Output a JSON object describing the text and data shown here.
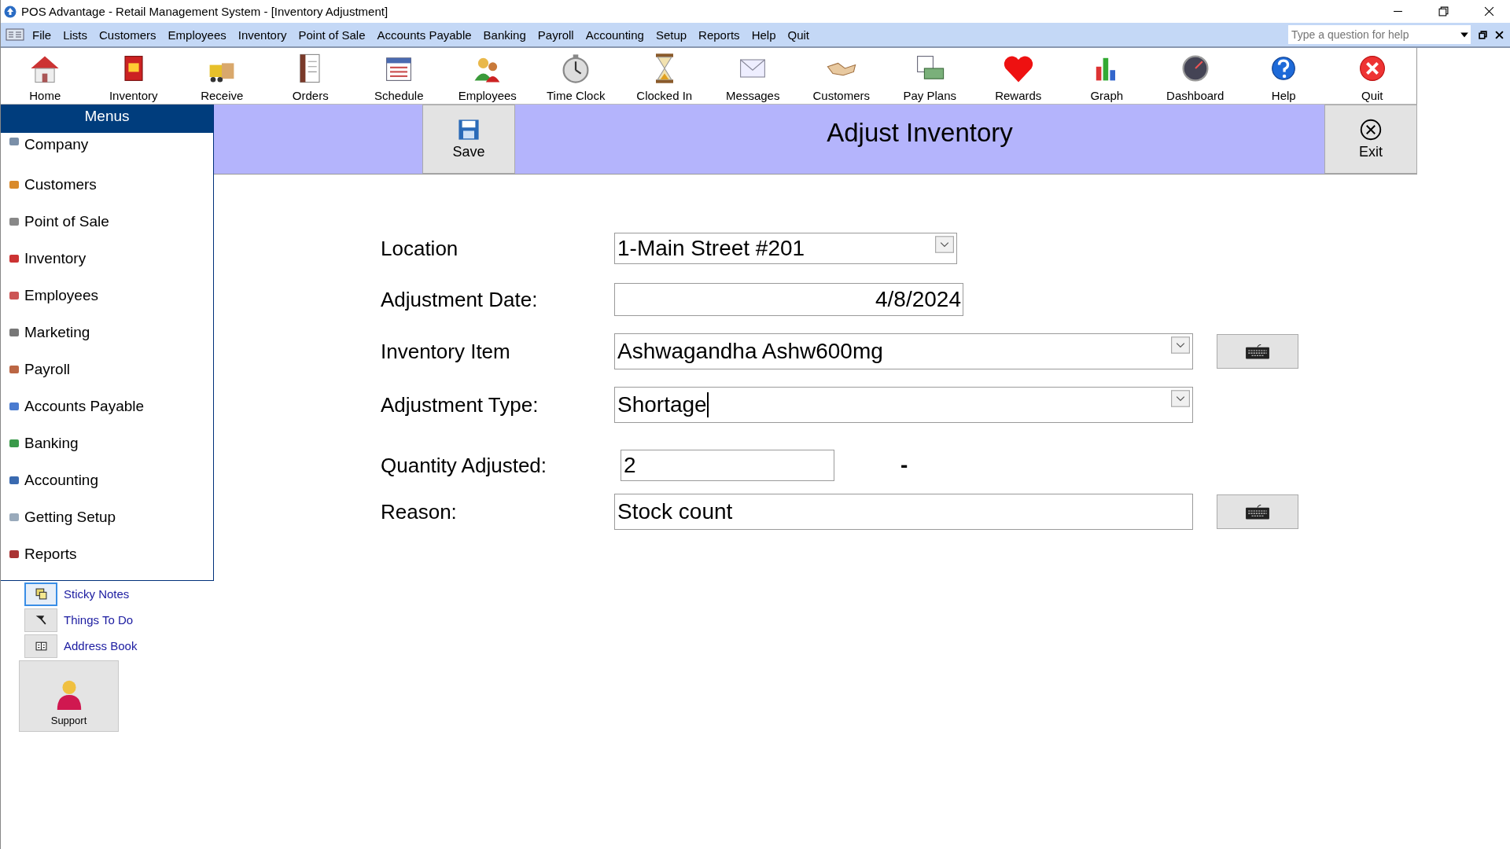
{
  "window": {
    "title": "POS Advantage - Retail Management System - [Inventory Adjustment]"
  },
  "menu_bar": {
    "items": [
      "File",
      "Lists",
      "Customers",
      "Employees",
      "Inventory",
      "Point of Sale",
      "Accounts Payable",
      "Banking",
      "Payroll",
      "Accounting",
      "Setup",
      "Reports",
      "Help",
      "Quit"
    ],
    "help_search": {
      "placeholder": "Type a question for help"
    }
  },
  "toolbar": [
    {
      "label": "Home"
    },
    {
      "label": "Inventory"
    },
    {
      "label": "Receive"
    },
    {
      "label": "Orders"
    },
    {
      "label": "Schedule"
    },
    {
      "label": "Employees"
    },
    {
      "label": "Time Clock"
    },
    {
      "label": "Clocked In"
    },
    {
      "label": "Messages"
    },
    {
      "label": "Customers"
    },
    {
      "label": "Pay Plans"
    },
    {
      "label": "Rewards"
    },
    {
      "label": "Graph"
    },
    {
      "label": "Dashboard"
    },
    {
      "label": "Help"
    },
    {
      "label": "Quit"
    }
  ],
  "sidebar": {
    "title": "Menus",
    "items": [
      "Company",
      "Customers",
      "Point of Sale",
      "Inventory",
      "Employees",
      "Marketing",
      "Payroll",
      "Accounts Payable",
      "Banking",
      "Accounting",
      "Getting Setup",
      "Reports"
    ],
    "shortcuts": [
      {
        "label": "Sticky Notes",
        "selected": true
      },
      {
        "label": "Things To Do",
        "selected": false
      },
      {
        "label": "Address Book",
        "selected": false
      }
    ],
    "support": "Support"
  },
  "header": {
    "title": "Adjust Inventory",
    "save": "Save",
    "exit": "Exit"
  },
  "form": {
    "location": {
      "label": "Location",
      "value": "1-Main Street #201"
    },
    "date": {
      "label": "Adjustment Date:",
      "value": "4/8/2024"
    },
    "item": {
      "label": "Inventory Item",
      "value": "Ashwagandha Ashw600mg"
    },
    "type": {
      "label": "Adjustment Type:",
      "value": "Shortage"
    },
    "quantity": {
      "label": "Quantity Adjusted:",
      "value": "2",
      "sign": "-"
    },
    "reason": {
      "label": "Reason:",
      "value": "Stock count"
    }
  }
}
